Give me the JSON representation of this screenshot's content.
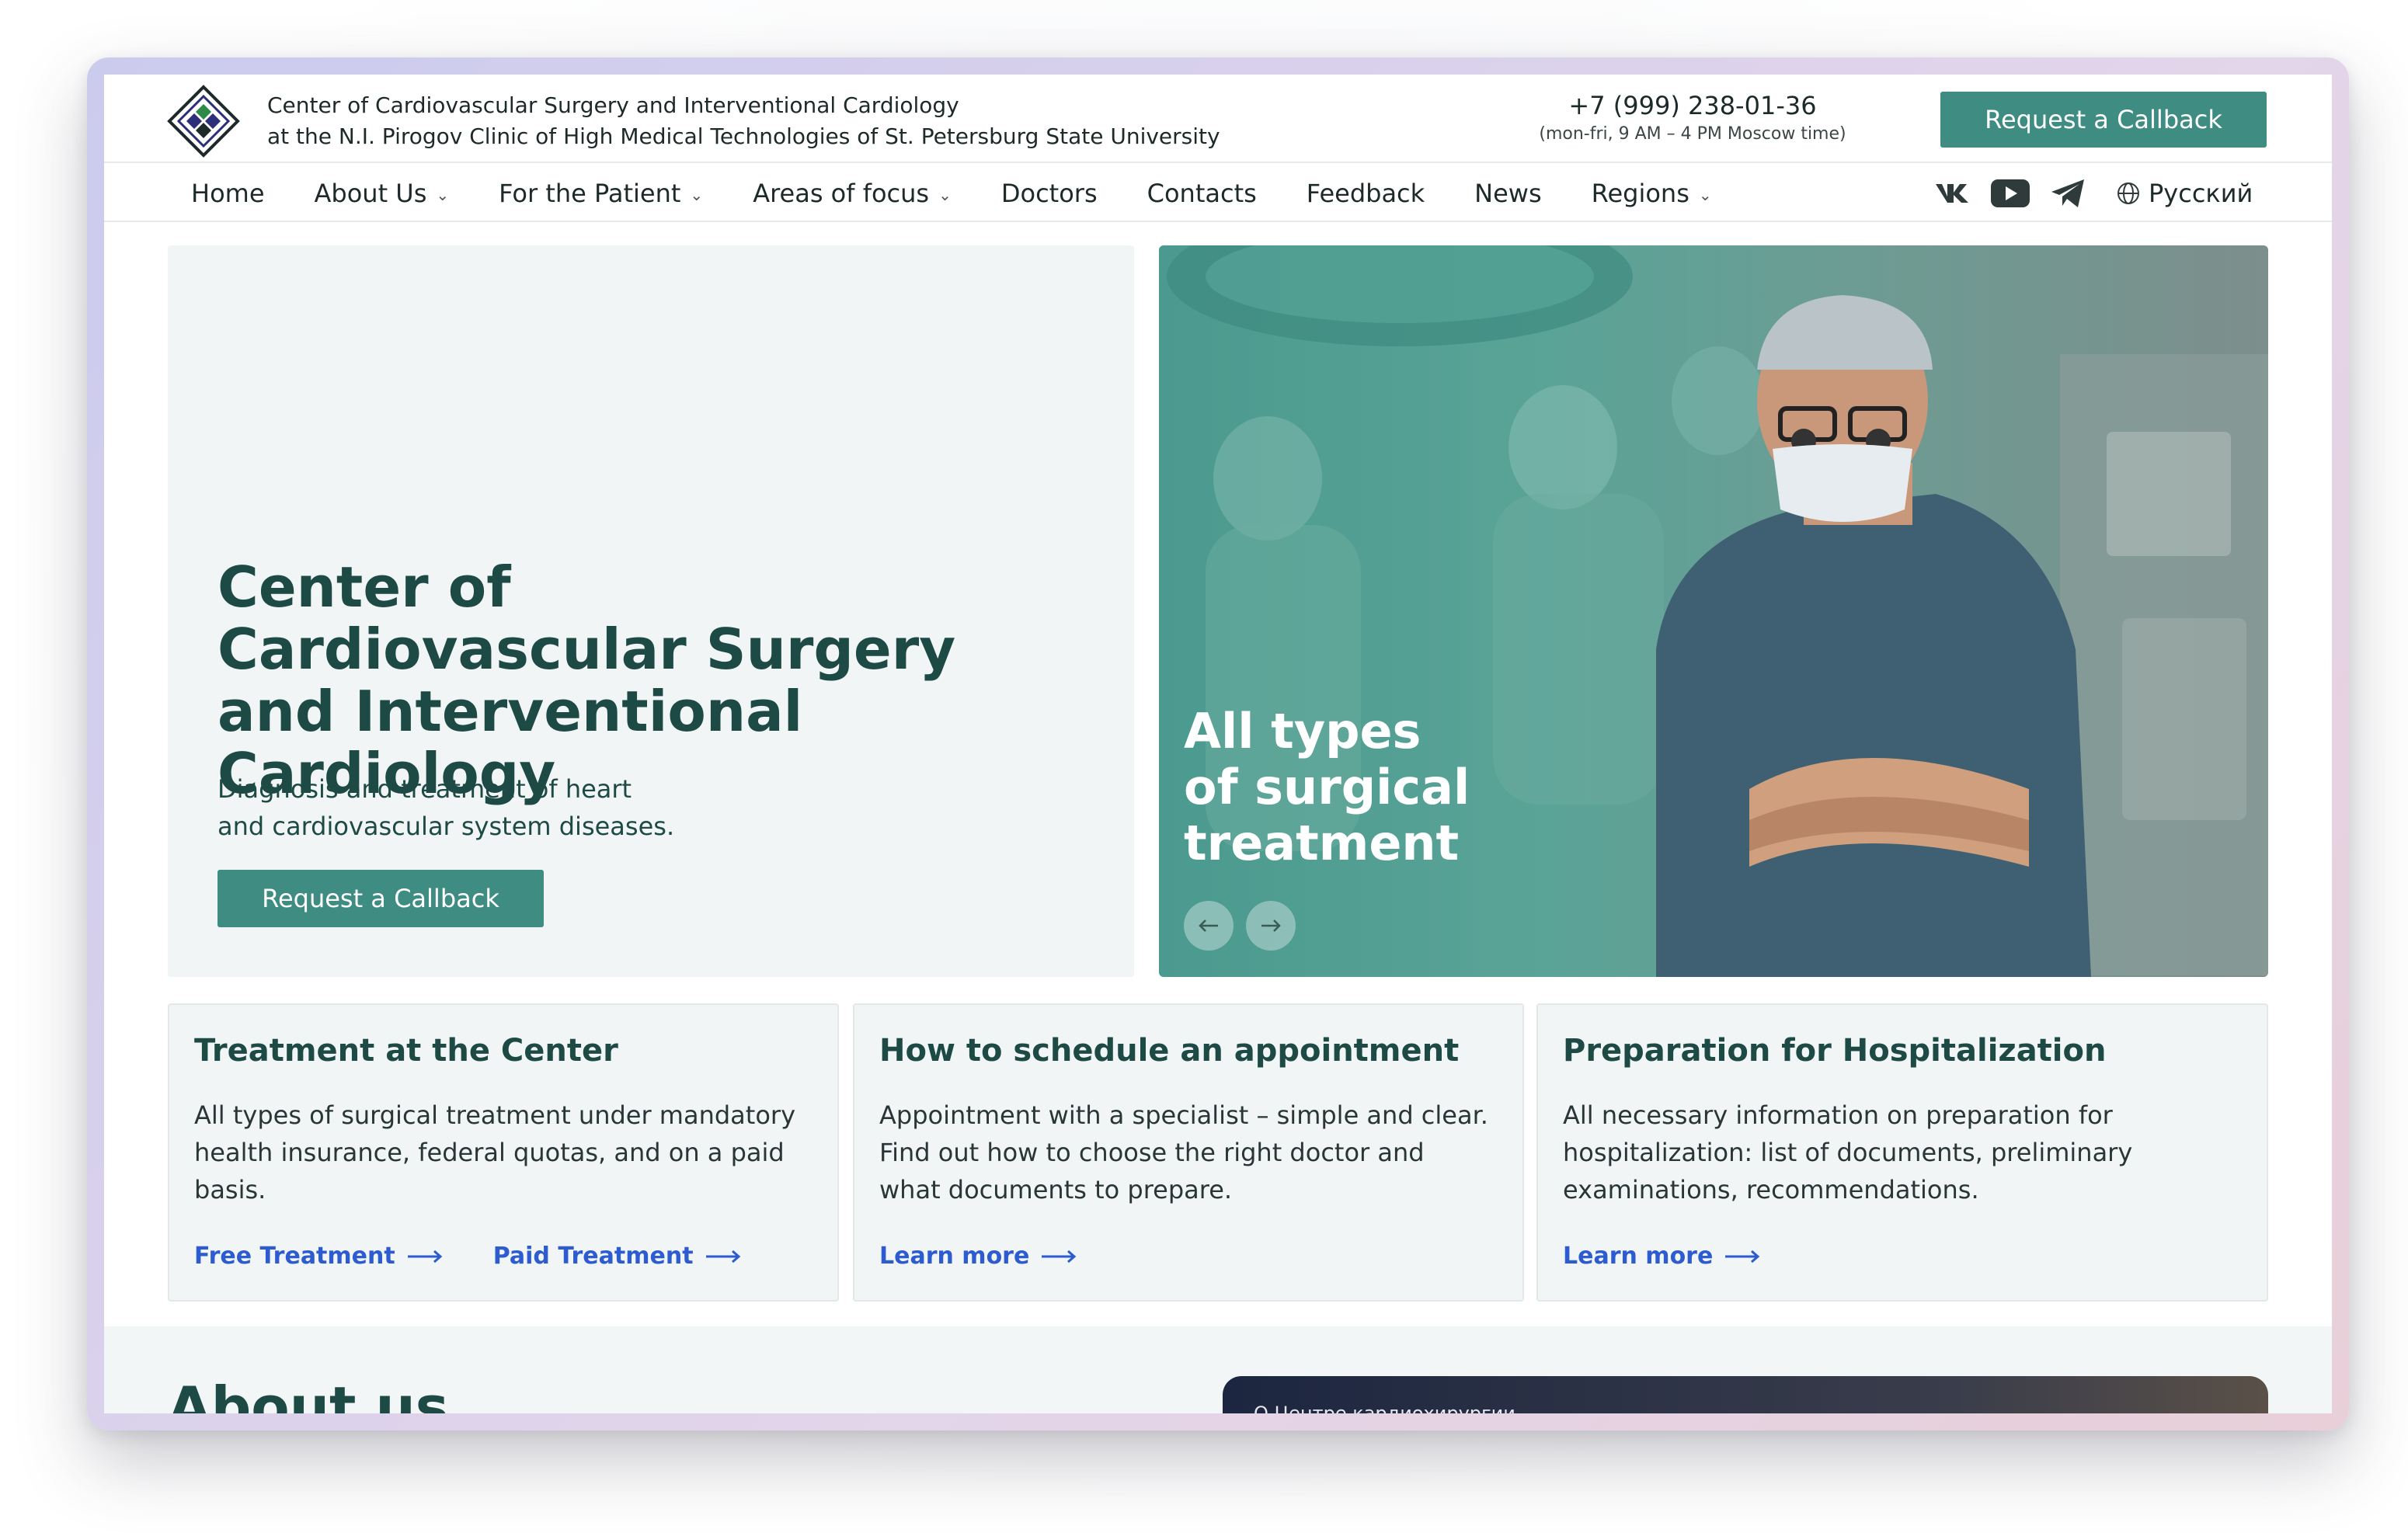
{
  "header": {
    "org_name_line1": "Center of Cardiovascular Surgery and Interventional Cardiology",
    "org_name_line2": "at the N.I. Pirogov Clinic of High Medical Technologies of St. Petersburg State University",
    "phone": "+7 (999) 238-01-36",
    "hours": "(mon-fri, 9 AM – 4 PM Moscow time)",
    "callback_label": "Request a Callback"
  },
  "nav": {
    "items": [
      {
        "label": "Home",
        "dropdown": false
      },
      {
        "label": "About Us",
        "dropdown": true
      },
      {
        "label": "For the Patient",
        "dropdown": true
      },
      {
        "label": "Areas of focus",
        "dropdown": true
      },
      {
        "label": "Doctors",
        "dropdown": false
      },
      {
        "label": "Contacts",
        "dropdown": false
      },
      {
        "label": "Feedback",
        "dropdown": false
      },
      {
        "label": "News",
        "dropdown": false
      },
      {
        "label": "Regions",
        "dropdown": true
      }
    ],
    "socials": [
      "vk-icon",
      "youtube-icon",
      "telegram-icon"
    ],
    "language": "Русский"
  },
  "hero": {
    "title_line1": "Center of",
    "title_line2": "Cardiovascular Surgery",
    "title_line3": "and Interventional Cardiology",
    "subtitle_line1": "Diagnosis and treatment of heart",
    "subtitle_line2": "and cardiovascular system diseases.",
    "button_label": "Request a Callback"
  },
  "slider": {
    "caption_line1": "All types",
    "caption_line2": "of surgical",
    "caption_line3": "treatment"
  },
  "cards": [
    {
      "title": "Treatment at the Center",
      "text": "All types of surgical treatment under mandatory health insurance, federal quotas, and on a paid basis.",
      "links": [
        "Free Treatment",
        "Paid Treatment"
      ]
    },
    {
      "title": "How to schedule an appointment",
      "text": "Appointment with a specialist – simple and clear. Find out how to choose the right doctor and what documents to prepare.",
      "links": [
        "Learn more"
      ]
    },
    {
      "title": "Preparation for Hospitalization",
      "text": "All necessary information on preparation for hospitalization: list of documents, preliminary examinations, recommendations.",
      "links": [
        "Learn more"
      ]
    }
  ],
  "about": {
    "title": "About us",
    "video_caption": "О Центре кардиохирургии"
  },
  "colors": {
    "accent": "#3e8c82",
    "heading": "#1e4a45",
    "link": "#2d5bd0",
    "panel": "#f1f5f5"
  }
}
